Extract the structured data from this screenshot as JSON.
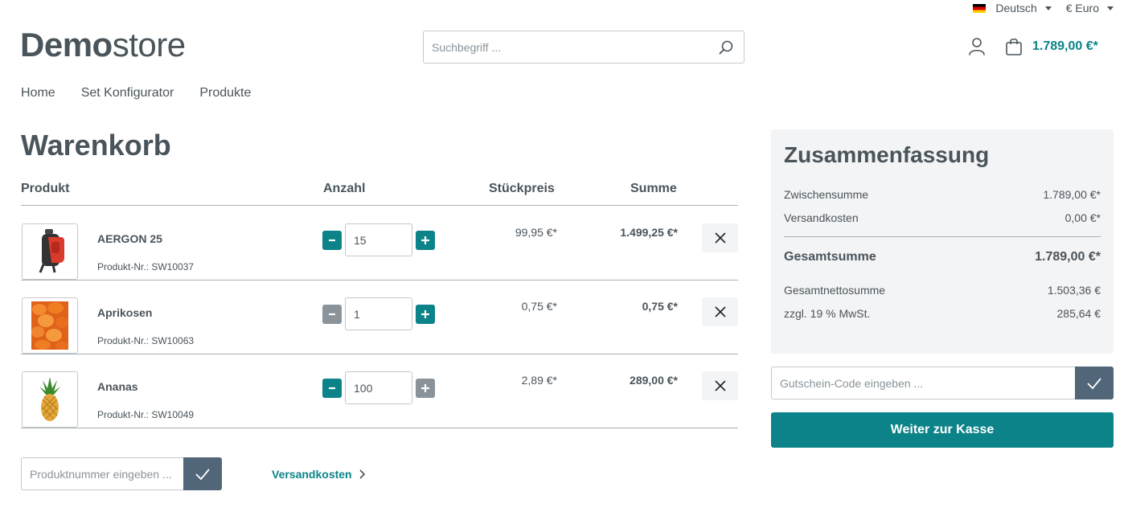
{
  "topbar": {
    "language": "Deutsch",
    "currency": "€ Euro"
  },
  "header": {
    "logo_bold": "Demo",
    "logo_light": "store",
    "search_placeholder": "Suchbegriff ...",
    "cart_total": "1.789,00 €*"
  },
  "nav": {
    "items": [
      {
        "label": "Home"
      },
      {
        "label": "Set Konfigurator"
      },
      {
        "label": "Produkte"
      }
    ]
  },
  "cart": {
    "title": "Warenkorb",
    "columns": {
      "product": "Produkt",
      "quantity": "Anzahl",
      "unit_price": "Stückpreis",
      "total": "Summe"
    },
    "items": [
      {
        "name": "AERGON 25",
        "number": "Produkt-Nr.: SW10037",
        "quantity": "15",
        "unit_price": "99,95 €*",
        "total": "1.499,25 €*",
        "image_icon": "backpack-image"
      },
      {
        "name": "Aprikosen",
        "number": "Produkt-Nr.: SW10063",
        "quantity": "1",
        "unit_price": "0,75 €*",
        "total": "0,75 €*",
        "image_icon": "apricots-image"
      },
      {
        "name": "Ananas",
        "number": "Produkt-Nr.: SW10049",
        "quantity": "100",
        "unit_price": "2,89 €*",
        "total": "289,00 €*",
        "image_icon": "pineapple-image"
      }
    ],
    "product_number_placeholder": "Produktnummer eingeben ...",
    "shipping_link": "Versandkosten"
  },
  "summary": {
    "title": "Zusammenfassung",
    "subtotal_label": "Zwischensumme",
    "subtotal_value": "1.789,00 €*",
    "shipping_label": "Versandkosten",
    "shipping_value": "0,00 €*",
    "grand_total_label": "Gesamtsumme",
    "grand_total_value": "1.789,00 €*",
    "net_label": "Gesamtnettosumme",
    "net_value": "1.503,36 €",
    "tax_label": "zzgl. 19 % MwSt.",
    "tax_value": "285,64 €",
    "voucher_placeholder": "Gutschein-Code eingeben ...",
    "checkout_label": "Weiter zur Kasse"
  },
  "colors": {
    "accent": "#0b8388",
    "secondary_button": "#52667a",
    "text": "#4a545b"
  }
}
